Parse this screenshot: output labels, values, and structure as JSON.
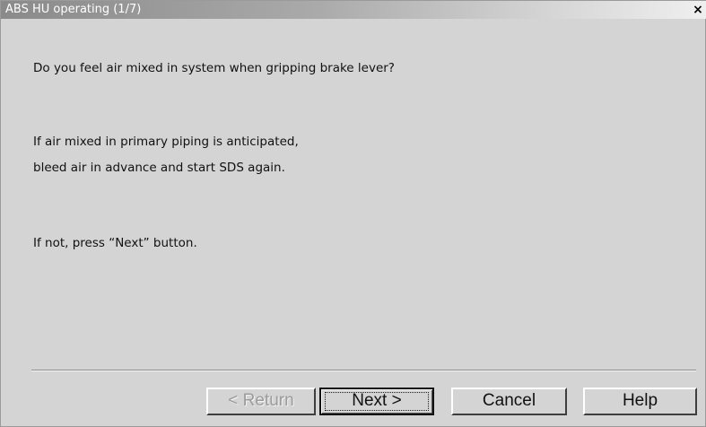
{
  "window": {
    "title": "ABS HU operating (1/7)",
    "close_glyph": "×",
    "close_icon": "close-icon"
  },
  "message": {
    "line1": "Do you feel air mixed in system when gripping brake lever?",
    "line2": "If air mixed in primary piping is anticipated,",
    "line3": "bleed air in advance and start SDS again.",
    "line4": "If not, press “Next” button."
  },
  "buttons": {
    "return_label": "< Return",
    "return_enabled": false,
    "next_label": "Next >",
    "next_is_default": true,
    "cancel_label": "Cancel",
    "help_label": "Help"
  },
  "colors": {
    "window_bg": "#d4d4d4",
    "titlebar_gradient_start": "#8a8a8a",
    "titlebar_gradient_end": "#efefef",
    "disabled_text": "#9b9b9b"
  }
}
